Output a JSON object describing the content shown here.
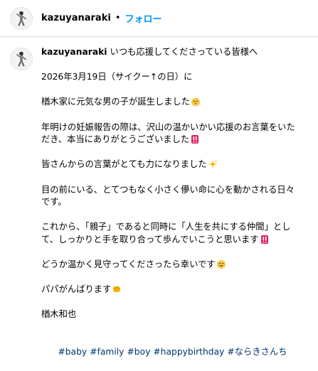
{
  "header": {
    "username": "kazuyanaraki",
    "separator": "•",
    "follow_label": "フォロー"
  },
  "caption": {
    "username": "kazuyanaraki",
    "first_line": "いつも応援してくださっている皆様へ",
    "paragraphs": [
      "2026年3月19日（サイクー↑の日）に",
      "楢木家に元気な男の子が誕生しました",
      "年明けの妊娠報告の際は、沢山の温かいかい応援のお言葉をいただき、本当にありがとうございました",
      "皆さんからの言葉がとても力になりました",
      "目の前にいる、とてつもなく小さく儚い命に心を動かされる日々です。",
      "これから、「親子」であると同時に「人生を共にする仲間」として、しっかりと手を取り合って歩んでいこうと思います",
      "どうか温かく見守ってくださったら幸いです",
      "パパがんばります",
      "楢木和也"
    ],
    "hashtags": [
      "#baby",
      "#family",
      "#boy",
      "#happybirthday",
      "#ならきさんち"
    ]
  },
  "icons": {
    "p2": "baby-chick-icon",
    "p3": "double-exclamation-icon",
    "p4": "sparkles-icon",
    "p6": "double-exclamation-icon",
    "p7": "smiling-face-icon",
    "p8": "fist-bump-icon"
  },
  "colors": {
    "link": "#00376b",
    "follow": "#0095f6",
    "divider": "#dbdbdb"
  }
}
